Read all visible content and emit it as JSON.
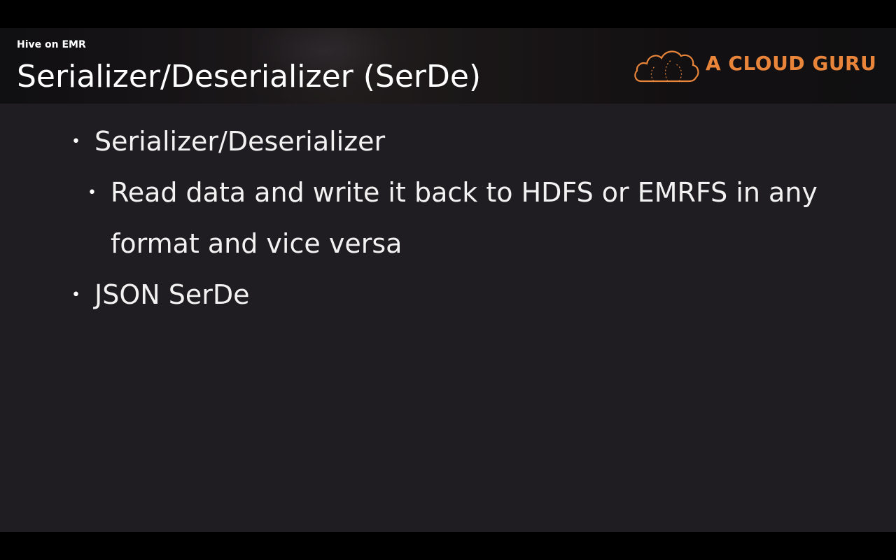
{
  "header": {
    "course_label": "Hive on EMR",
    "title": "Serializer/Deserializer (SerDe)"
  },
  "logo": {
    "text": "A CLOUD GURU",
    "icon": "cloud-icon",
    "color": "#e9853a"
  },
  "bullets": [
    {
      "level": 1,
      "marker": "•",
      "text": "Serializer/Deserializer"
    },
    {
      "level": 2,
      "marker": "•",
      "text": "Read data and write it back to HDFS or EMRFS in any"
    },
    {
      "level": 2,
      "marker": "",
      "text": "format and vice versa"
    },
    {
      "level": 1,
      "marker": "•",
      "text": "JSON SerDe"
    }
  ],
  "colors": {
    "background": "#1f1d21",
    "text": "#ffffff",
    "accent": "#e9853a"
  }
}
